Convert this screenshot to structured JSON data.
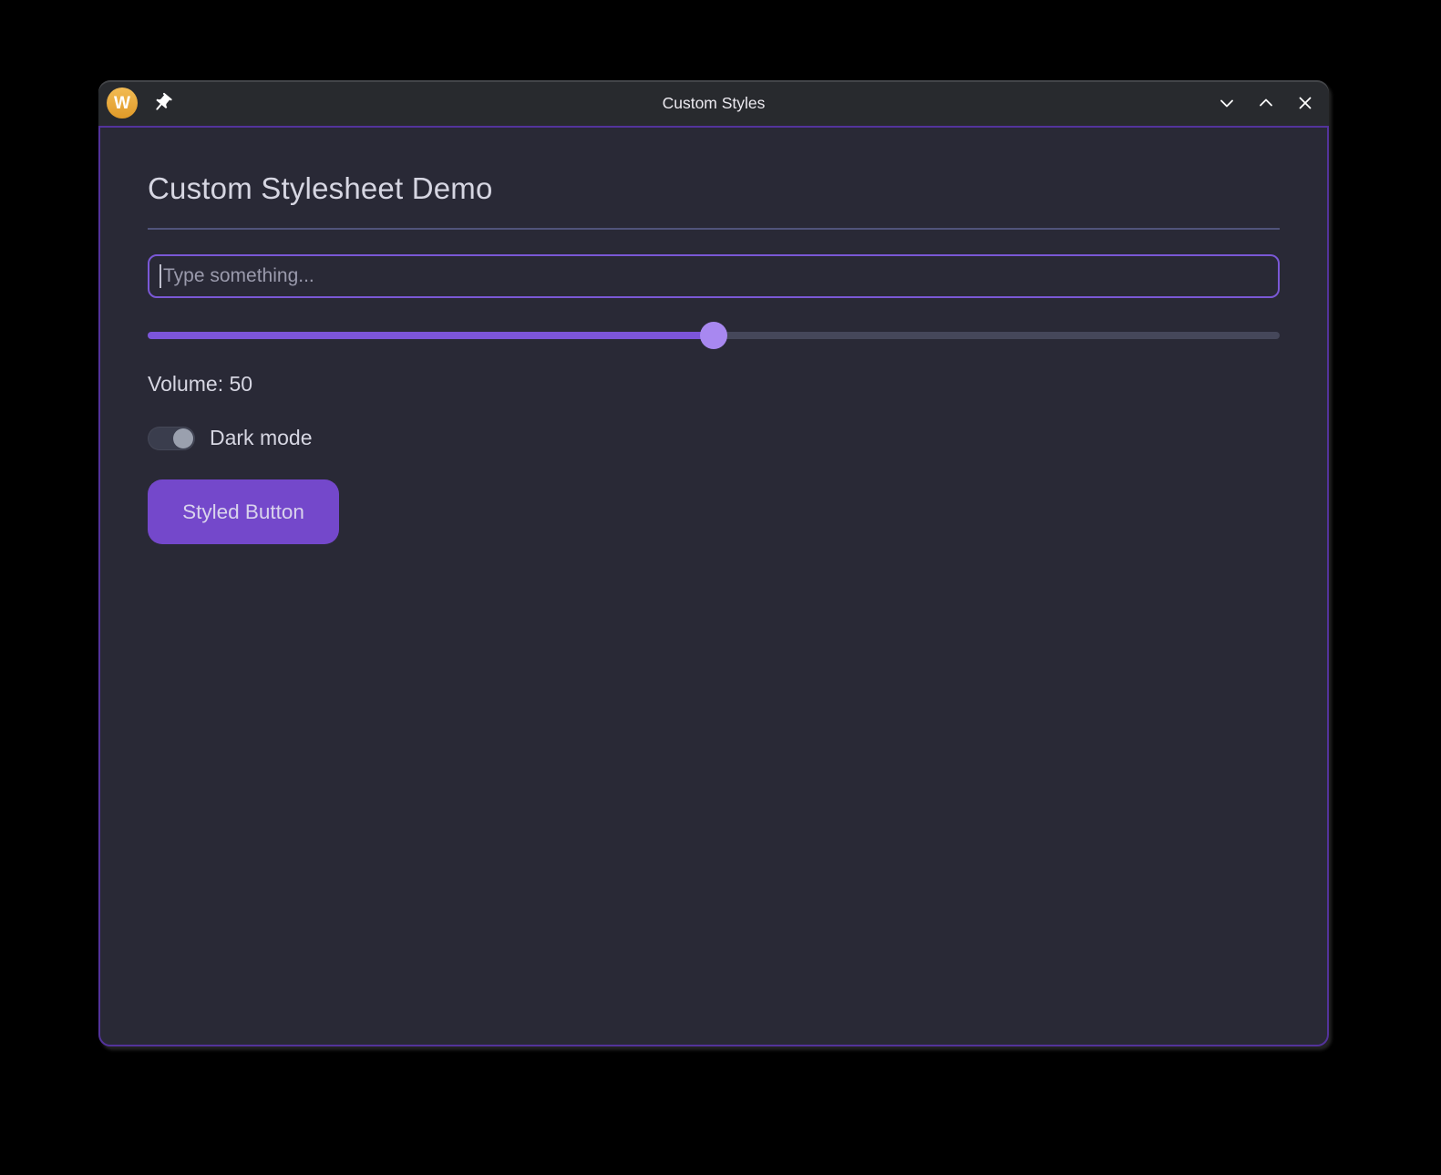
{
  "window": {
    "title": "Custom Styles",
    "icon_letter": "W",
    "controls": {
      "minimize": "chevron-down",
      "maximize": "chevron-up",
      "close": "x"
    }
  },
  "content": {
    "heading": "Custom Stylesheet Demo",
    "input": {
      "value": "",
      "placeholder": "Type something..."
    },
    "slider": {
      "value": 50,
      "min": 0,
      "max": 100
    },
    "volume_label": "Volume: 50",
    "toggle": {
      "label": "Dark mode",
      "checked": false
    },
    "button_label": "Styled Button"
  },
  "colors": {
    "accent": "#7a55d4",
    "button_bg": "#7448cb",
    "slider_fill": "#7c55da",
    "slider_handle": "#a888f0",
    "slider_track": "#45475a",
    "input_border": "#7a58d6",
    "window_border": "#53339b",
    "titlebar_bg": "#282a2e",
    "content_bg": "#292936",
    "divider": "#50537a",
    "text": "#d6d6e2",
    "placeholder": "#9a9aac",
    "toggle_track": "#3a3d4d",
    "toggle_knob": "#9aa0ae",
    "app_icon_bg": "#e9a33c",
    "title_text": "#eceaf0"
  }
}
